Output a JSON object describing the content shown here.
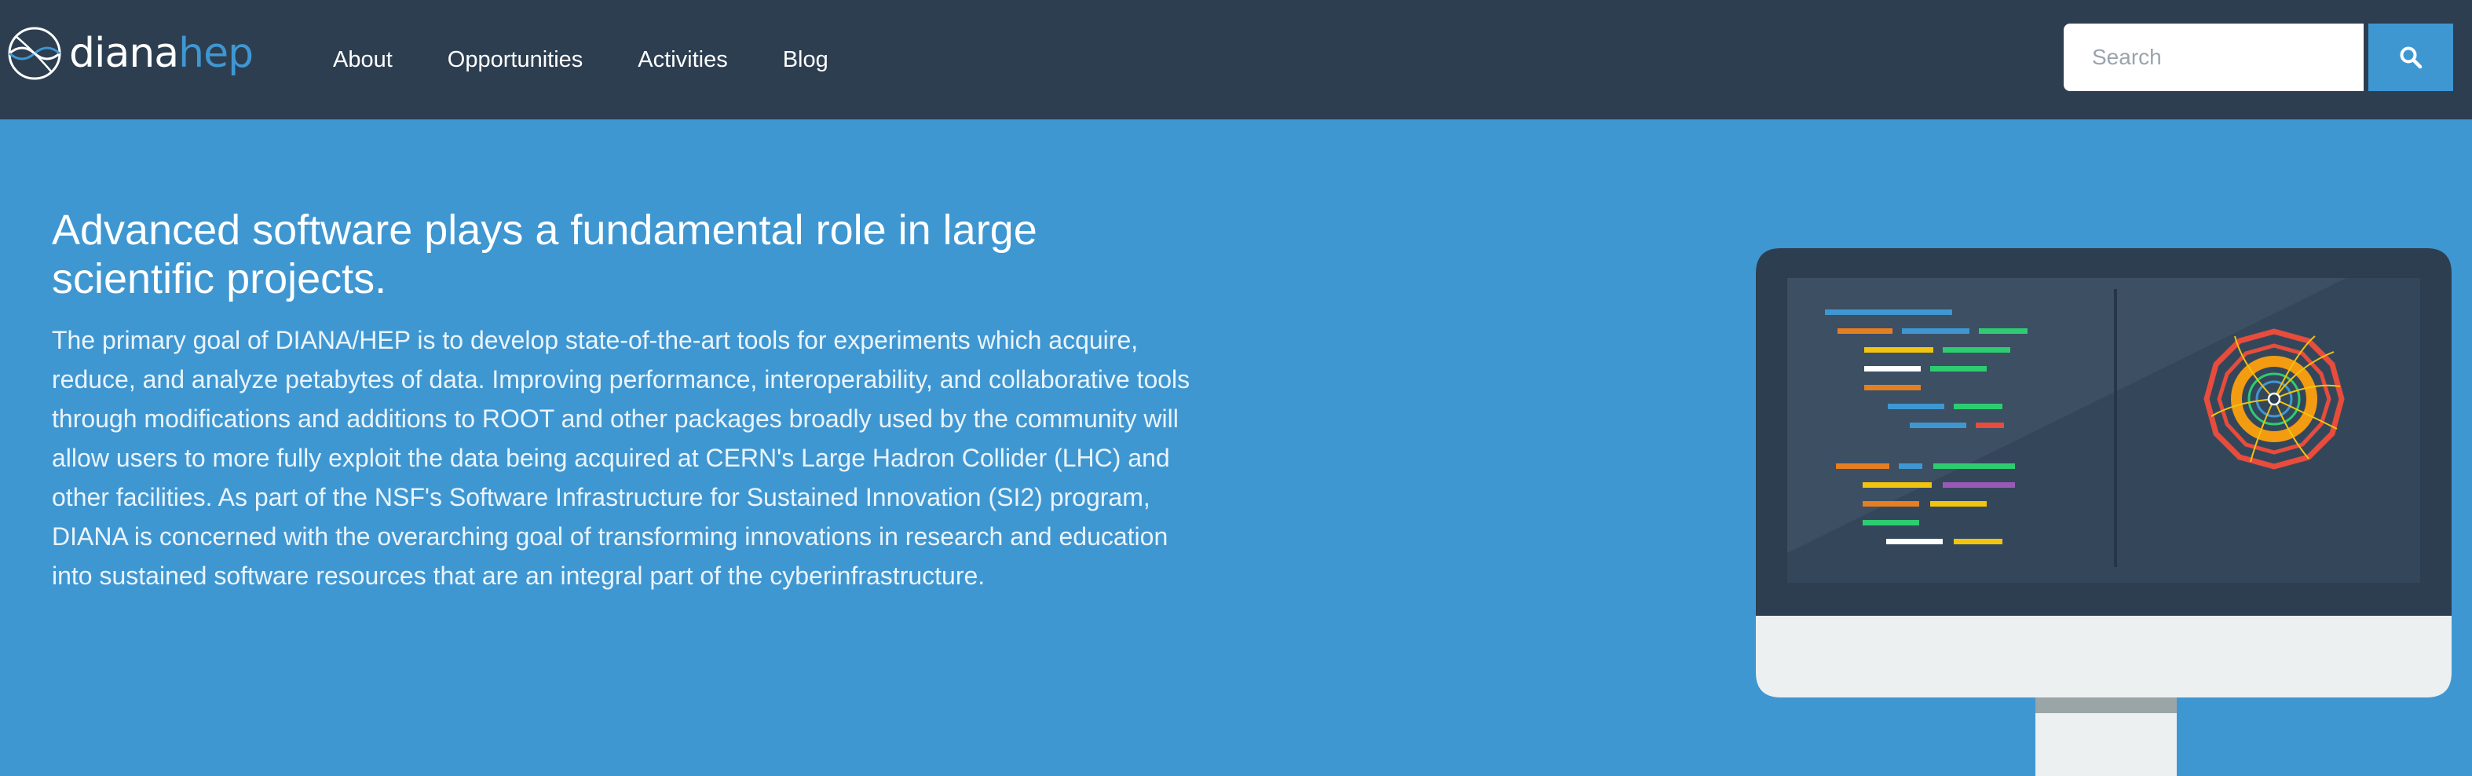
{
  "brand": {
    "logo_primary": "diana",
    "logo_accent": "hep"
  },
  "nav": {
    "items": [
      {
        "label": "About"
      },
      {
        "label": "Opportunities"
      },
      {
        "label": "Activities"
      },
      {
        "label": "Blog"
      }
    ]
  },
  "search": {
    "placeholder": "Search",
    "value": ""
  },
  "hero": {
    "title": "Advanced software plays a fundamental role in large scientific projects.",
    "body": "The primary goal of DIANA/HEP is to develop state-of-the-art tools for experiments which acquire, reduce, and analyze petabytes of data. Improving performance, interoperability, and collaborative tools through modifications and additions to ROOT and other packages broadly used by the community will allow users to more fully exploit the data being acquired at CERN's Large Hadron Collider (LHC) and other facilities. As part of the NSF's Software Infrastructure for Sustained Innovation (SI2) program, DIANA is concerned with the overarching goal of transforming innovations in research and education into sustained software resources that are an integral part of the cyberinfrastructure."
  },
  "colors": {
    "navbar": "#2c3e50",
    "accent": "#3f97d2",
    "hero_background": "#3f97d2",
    "text": "#ffffff"
  },
  "icons": {
    "logo": "detector-logo-icon",
    "search": "search-icon",
    "illustration": "monitor-illustration"
  }
}
